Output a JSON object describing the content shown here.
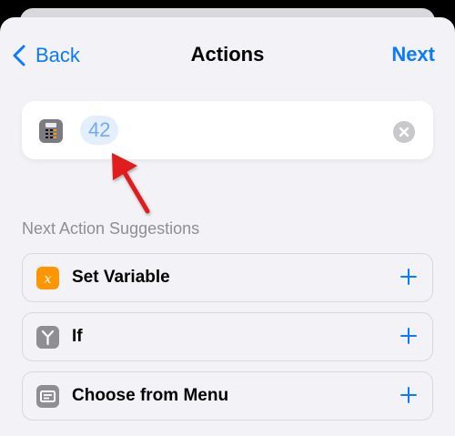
{
  "nav": {
    "back_label": "Back",
    "title": "Actions",
    "next_label": "Next"
  },
  "action_card": {
    "icon": "calculator-icon",
    "value": "42"
  },
  "suggestions": {
    "header": "Next Action Suggestions",
    "items": [
      {
        "label": "Set Variable",
        "icon": "variable-icon",
        "color": "#ff9500"
      },
      {
        "label": "If",
        "icon": "branch-icon",
        "color": "#8e8e93"
      },
      {
        "label": "Choose from Menu",
        "icon": "menu-icon",
        "color": "#8e8e93"
      }
    ]
  },
  "colors": {
    "accent": "#0a7aff",
    "annotation_arrow": "#e01a1a"
  }
}
